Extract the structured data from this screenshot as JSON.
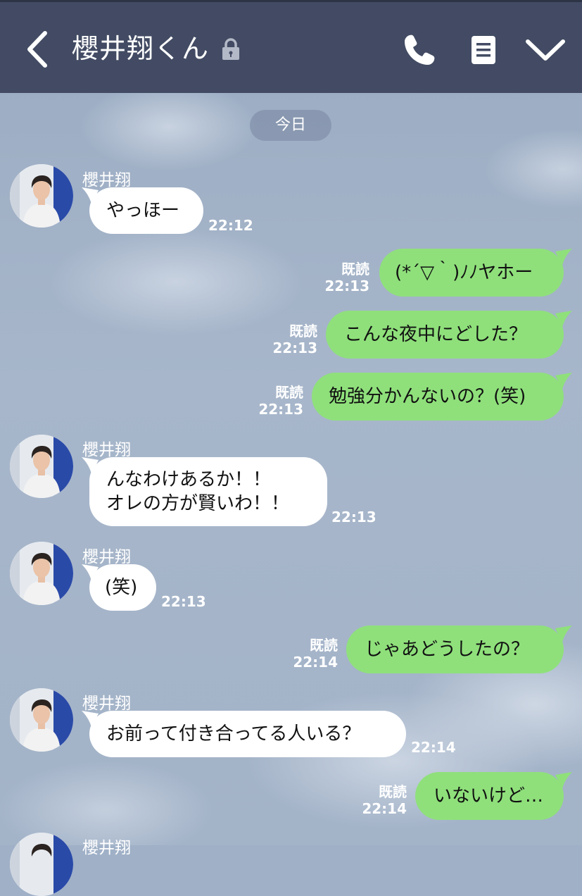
{
  "header": {
    "title": "櫻井翔くん"
  },
  "date_chip": "今日",
  "messages": [
    {
      "sender": "櫻井翔",
      "text": "やっほー",
      "time": "22:12"
    },
    {
      "read": "既読",
      "time": "22:13",
      "text": "(*´▽｀)ﾉﾉヤホー"
    },
    {
      "read": "既読",
      "time": "22:13",
      "text": "こんな夜中にどした？"
    },
    {
      "read": "既読",
      "time": "22:13",
      "text": "勉強分かんないの？(笑)"
    },
    {
      "sender": "櫻井翔",
      "line1": "んなわけあるか！！",
      "line2": "オレの方が賢いわ！！",
      "time": "22:13"
    },
    {
      "sender": "櫻井翔",
      "text": "(笑)",
      "time": "22:13"
    },
    {
      "read": "既読",
      "time": "22:14",
      "text": "じゃあどうしたの？"
    },
    {
      "sender": "櫻井翔",
      "text": "お前って付き合ってる人いる？",
      "time": "22:14"
    },
    {
      "read": "既読",
      "time": "22:14",
      "text": "いないけど…"
    },
    {
      "sender": "櫻井翔"
    }
  ],
  "colors": {
    "header": "#424b63",
    "outgoing_bubble": "#8fe07b",
    "incoming_bubble": "#ffffff"
  },
  "icons": [
    "back-icon",
    "lock-icon",
    "phone-icon",
    "note-icon",
    "chevron-down-icon",
    "avatar"
  ]
}
